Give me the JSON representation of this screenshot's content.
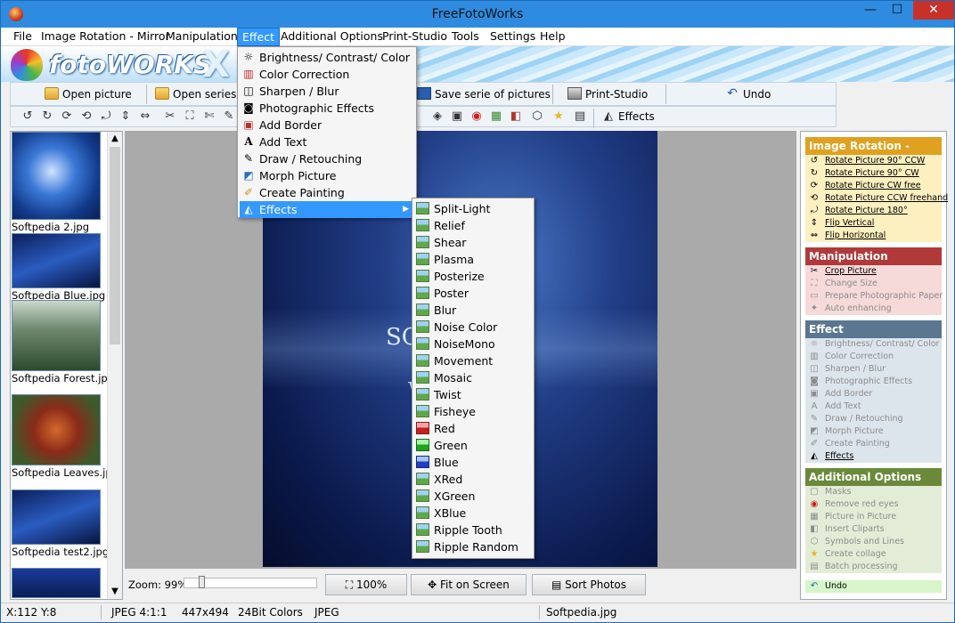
{
  "window": {
    "title": "FreeFotoWorks",
    "controls": {
      "minimize": "—",
      "maximize": "☐",
      "close": "✕"
    }
  },
  "menubar": [
    "File",
    "Image Rotation - Mirror",
    "Manipulation",
    "Effect",
    "Additional Options",
    "Print-Studio",
    "Tools",
    "Settings",
    "Help"
  ],
  "menubar_active": "Effect",
  "logo": {
    "text": "fotoWORKS",
    "mark": "X"
  },
  "toolbar1": {
    "open_picture": "Open picture",
    "open_series": "Open series of",
    "save_serie": "Save serie of pictures",
    "print_studio": "Print-Studio",
    "undo": "Undo"
  },
  "toolbar2": {
    "effects": "Effects"
  },
  "thumbnails": [
    {
      "label": "Softpedia 2.jpg"
    },
    {
      "label": "Softpedia Blue.jpg"
    },
    {
      "label": "Softpedia Forest.jpg"
    },
    {
      "label": "Softpedia Leaves.jpg"
    },
    {
      "label": "Softpedia test2.jpg"
    }
  ],
  "photo": {
    "text": "SO",
    "text2": "W"
  },
  "zoom": {
    "label": "Zoom: 99%",
    "level_percent": 99,
    "btn_100": "100%",
    "btn_fit": "Fit on Screen",
    "btn_sort": "Sort Photos"
  },
  "effect_menu": [
    {
      "label": "Brightness/ Contrast/ Color",
      "icon": "brightness-icon"
    },
    {
      "label": "Color Correction",
      "icon": "color-correction-icon"
    },
    {
      "label": "Sharpen / Blur",
      "icon": "sharpen-icon"
    },
    {
      "label": "Photographic Effects",
      "icon": "camera-icon"
    },
    {
      "label": "Add Border",
      "icon": "border-icon"
    },
    {
      "label": "Add Text",
      "icon": "text-icon"
    },
    {
      "label": "Draw / Retouching",
      "icon": "draw-icon"
    },
    {
      "label": "Morph Picture",
      "icon": "morph-icon"
    },
    {
      "label": "Create Painting",
      "icon": "painting-icon"
    },
    {
      "label": "Effects",
      "icon": "effects-icon"
    }
  ],
  "effects_submenu": [
    "Split-Light",
    "Relief",
    "Shear",
    "Plasma",
    "Posterize",
    "Poster",
    "Blur",
    "Noise Color",
    "NoiseMono",
    "Movement",
    "Mosaic",
    "Twist",
    "Fisheye",
    "Red",
    "Green",
    "Blue",
    "XRed",
    "XGreen",
    "XBlue",
    "Ripple Tooth",
    "Ripple Random"
  ],
  "side_panel": {
    "rotation": {
      "title": "Image Rotation - Mirror",
      "color": "#e0a020",
      "items": [
        "Rotate Picture 90° CCW",
        "Rotate Picture 90° CW",
        "Rotate Picture CW free",
        "Rotate Picture CCW freehand",
        "Rotate Picture 180°",
        "Flip Vertical",
        "Flip Horizontal"
      ]
    },
    "manipulation": {
      "title": "Manipulation",
      "color": "#b03a3a",
      "items": [
        "Crop Picture",
        "Change Size",
        "Prepare Photographic Paper",
        "Auto enhancing"
      ]
    },
    "effect": {
      "title": "Effect",
      "color": "#5a7690",
      "items": [
        "Brightness/ Contrast/ Color",
        "Color Correction",
        "Sharpen / Blur",
        "Photographic Effects",
        "Add Border",
        "Add Text",
        "Draw / Retouching",
        "Morph Picture",
        "Create Painting",
        "Effects"
      ]
    },
    "additional": {
      "title": "Additional Options",
      "color": "#6a8a3a",
      "items": [
        "Masks",
        "Remove red eyes",
        "Picture in Picture",
        "Insert Cliparts",
        "Symbols and Lines",
        "Create collage",
        "Batch processing"
      ]
    },
    "undo": "Undo"
  },
  "status": {
    "coords": "X:112 Y:8",
    "format": "JPEG 4:1:1",
    "size": "447x494",
    "bits": "24Bit Colors",
    "type": "JPEG",
    "file": "Softpedia.jpg"
  }
}
